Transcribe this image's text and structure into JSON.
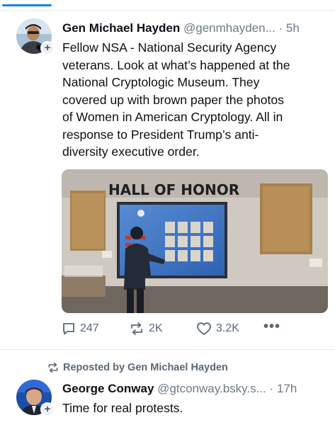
{
  "post1": {
    "author_name": "Gen Michael Hayden",
    "author_handle": "@genmhayden...",
    "time_sep": "·",
    "time": "5h",
    "follow_badge": "+",
    "text_lines": [
      "Fellow NSA - National Security Agency",
      "veterans. Look at what’s happened at the",
      "National Cryptologic Museum. They",
      "covered up with brown paper the photos",
      "of Women in American Cryptology. All in",
      "response to President Trump’s anti-",
      "diversity executive order."
    ],
    "image_sign_text": "HALL  OF  HONOR",
    "actions": {
      "replies": "247",
      "reposts": "2K",
      "likes": "3.2K",
      "more": "•••"
    },
    "icons": {
      "reply": "reply-icon",
      "repost": "repost-icon",
      "like": "heart-icon",
      "more": "more-icon"
    }
  },
  "post2": {
    "repost_label": "Reposted by Gen Michael Hayden",
    "author_name": "George Conway",
    "author_handle": "@gtconway.bsky.s...",
    "time_sep": "·",
    "time": "17h",
    "follow_badge": "+",
    "text": "Time for real protests."
  },
  "colors": {
    "accent": "#1083fe",
    "text": "#0b0f14",
    "muted": "#6f7a86",
    "divider": "#e6e9ed"
  }
}
